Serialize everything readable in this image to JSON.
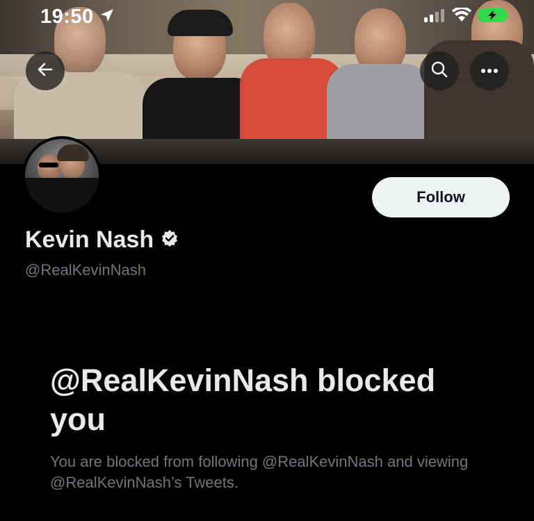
{
  "status_bar": {
    "time": "19:50",
    "location_icon": "location-arrow-icon",
    "signal_icon": "cellular-signal-icon",
    "wifi_icon": "wifi-icon",
    "battery_icon": "battery-charging-icon",
    "battery_color": "#32d74b"
  },
  "nav": {
    "back_icon": "arrow-left-icon",
    "search_icon": "search-icon",
    "more_icon": "more-icon"
  },
  "profile": {
    "name": "Kevin Nash",
    "handle": "@RealKevinNash",
    "verified_icon": "verified-badge-icon",
    "follow_label": "Follow"
  },
  "blocked": {
    "title": "@RealKevinNash blocked you",
    "message": "You are blocked from following @RealKevinNash and viewing @RealKevinNash’s Tweets."
  },
  "colors": {
    "background": "#000000",
    "primary_text": "#e7e9ea",
    "secondary_text": "#71767b",
    "follow_button_bg": "#eff3f4",
    "follow_button_text": "#0f1419"
  }
}
